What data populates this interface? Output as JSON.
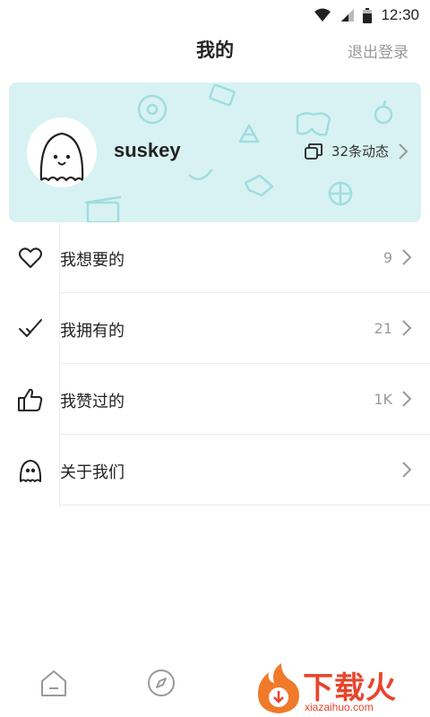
{
  "status_bar": {
    "time": "12:30",
    "icons": [
      "wifi-icon",
      "signal-icon",
      "battery-icon"
    ]
  },
  "header": {
    "title": "我的",
    "logout_label": "退出登录"
  },
  "profile": {
    "username": "suskey",
    "posts_label": "32条动态",
    "card_color": "#d8f2f3"
  },
  "menu": {
    "items": [
      {
        "icon": "heart-icon",
        "label": "我想要的",
        "count": "9"
      },
      {
        "icon": "check-icon",
        "label": "我拥有的",
        "count": "21"
      },
      {
        "icon": "thumbs-up-icon",
        "label": "我赞过的",
        "count": "1K"
      },
      {
        "icon": "ghost-icon",
        "label": "关于我们",
        "count": ""
      }
    ]
  },
  "bottom_nav": {
    "icons": [
      "home-icon",
      "compass-icon"
    ]
  },
  "watermark": {
    "text": "下载火",
    "sub": "xiazaihuo.com",
    "color": "#e8452c"
  }
}
